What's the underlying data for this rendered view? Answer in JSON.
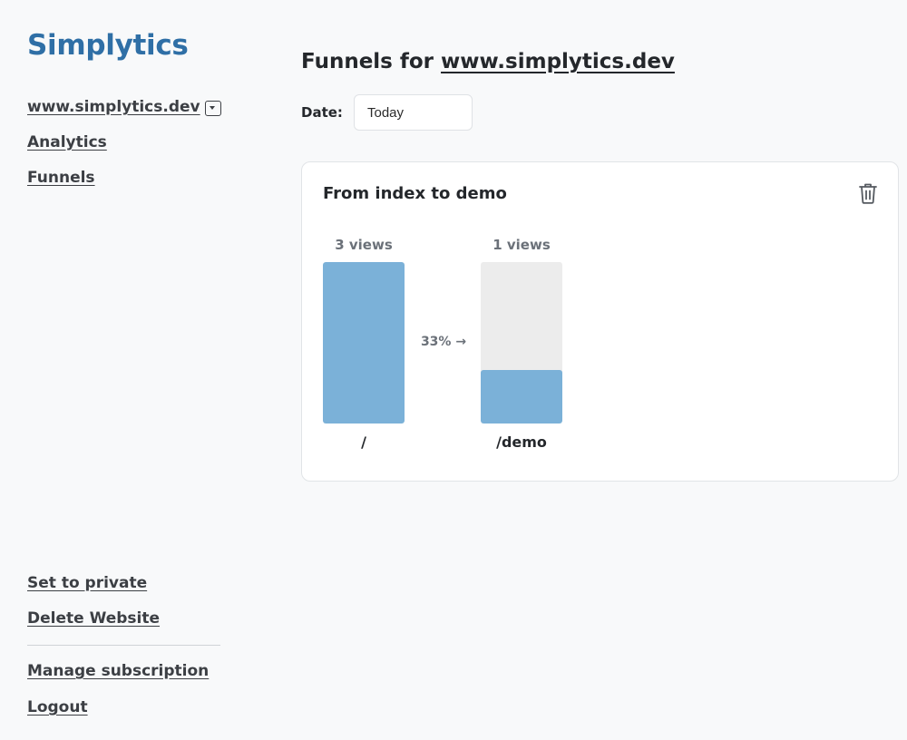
{
  "sidebar": {
    "logo": "Simplytics",
    "site_selector": "www.simplytics.dev",
    "nav": [
      {
        "label": "Analytics"
      },
      {
        "label": "Funnels"
      }
    ],
    "bottom": {
      "set_private": "Set to private",
      "delete_website": "Delete Website",
      "manage_subscription": "Manage subscription",
      "logout": "Logout"
    }
  },
  "main": {
    "title_prefix": "Funnels for ",
    "title_site": "www.simplytics.dev",
    "date_label": "Date:",
    "date_value": "Today",
    "funnel": {
      "title": "From index to demo",
      "delete_icon": "trash-icon",
      "steps": [
        {
          "path": "/",
          "views_label": "3 views",
          "views": 3,
          "fill_fraction": 1.0
        },
        {
          "path": "/demo",
          "views_label": "1 views",
          "views": 1,
          "fill_fraction": 0.33
        }
      ],
      "conversion_label": "33% →"
    }
  },
  "colors": {
    "brand": "#2f6fa6",
    "bar": "#7bb1d8",
    "bar_bg": "#ececec"
  }
}
